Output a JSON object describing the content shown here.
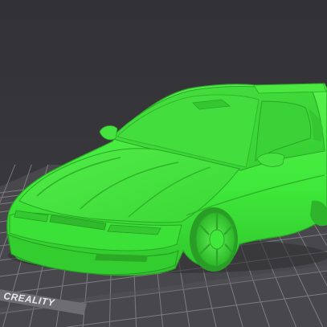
{
  "scene": {
    "background_color": "#37373b",
    "bed_color": "#4a4a4e",
    "grid_color": "#8a8a90",
    "model_color": "#3fe83a",
    "model_shadow_color": "#2aa826"
  },
  "bed": {
    "brand_label": "CREALITY"
  },
  "model": {
    "icon": "sports-car-model"
  }
}
